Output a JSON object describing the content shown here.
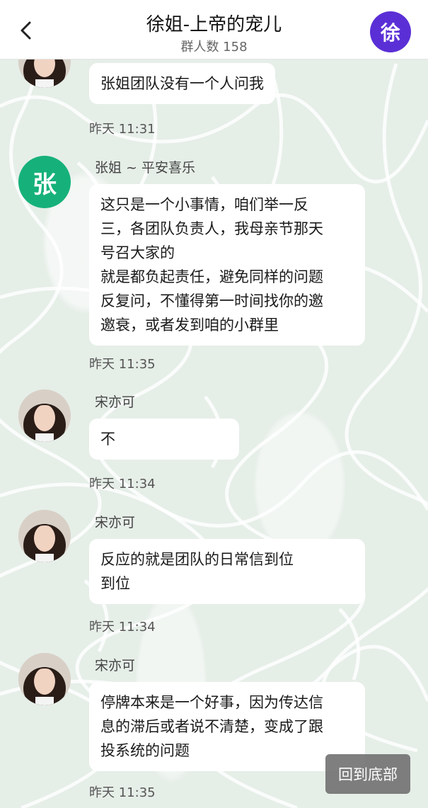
{
  "header": {
    "title": "徐姐-上帝的宠儿",
    "member_count": "群人数 158",
    "group_avatar_text": "徐"
  },
  "messages": [
    {
      "sender": "",
      "avatar": "photo",
      "text": "张姐团队没有一个人问我",
      "time": "昨天 11:31"
    },
    {
      "sender": "张姐 ~ 平安喜乐",
      "avatar": "张",
      "text": "这只是一个小事情，咱们举一反\n三，各团队负责人，我母亲节那天\n号召大家的\n就是都负起责任，避免同样的问题\n反复问，不懂得第一时间找你的邀\n邀衰，或者发到咱的小群里",
      "time": "昨天 11:35"
    },
    {
      "sender": "宋亦可",
      "avatar": "photo",
      "text": "不",
      "time": "昨天 11:34"
    },
    {
      "sender": "宋亦可",
      "avatar": "photo",
      "text": "反应的就是团队的日常信到位\n到位",
      "time": "昨天 11:34"
    },
    {
      "sender": "宋亦可",
      "avatar": "photo",
      "text": "停牌本来是一个好事，因为传达信\n息的滞后或者说不清楚，变成了跟\n投系统的问题",
      "time": "昨天 11:35"
    }
  ],
  "scroll_bottom_label": "回到底部",
  "colors": {
    "accent": "#5b2fd6",
    "zhang_avatar": "#16b17a"
  }
}
